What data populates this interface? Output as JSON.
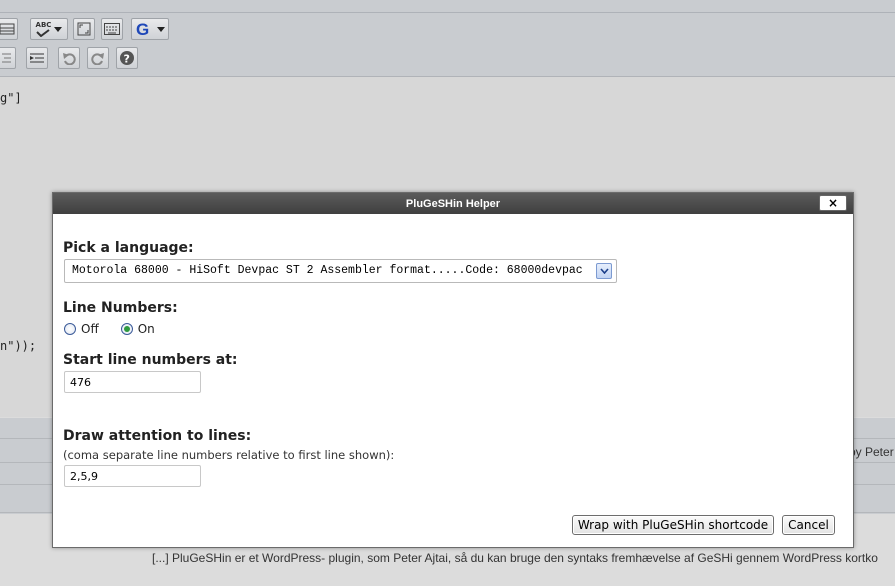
{
  "background": {
    "spellcheck_button_label": "ABC",
    "code_line_1": "g\"]",
    "code_line_2": "n\"));",
    "side_text": "by Peter",
    "excerpt": "[...] PluGeSHin er et WordPress- plugin, som Peter Ajtai, så du kan bruge den syntaks fremhævelse af GeSHi gennem WordPress kortko"
  },
  "dialog": {
    "title": "PluGeSHin Helper",
    "close_label": "×",
    "language": {
      "label": "Pick a language:",
      "selected": "Motorola 68000 - HiSoft Devpac ST 2 Assembler format.....Code: 68000devpac"
    },
    "line_numbers": {
      "label": "Line Numbers:",
      "options": [
        "Off",
        "On"
      ],
      "selected": "On"
    },
    "start_line": {
      "label": "Start line numbers at:",
      "value": "476"
    },
    "attention": {
      "label": "Draw attention to lines:",
      "hint": "(coma separate line numbers relative to first line shown):",
      "value": "2,5,9"
    },
    "buttons": {
      "wrap": "Wrap with PluGeSHin shortcode",
      "cancel": "Cancel"
    }
  },
  "colors": {
    "titlebar": "#4a4a4a",
    "radio_checked": "#2f9a3f",
    "overlay_background": "#d7d7d7"
  },
  "icons": [
    "table-icon",
    "spellcheck-icon",
    "fullscreen-icon",
    "keyboard-icon",
    "google-icon",
    "indent-icon",
    "outdent-icon",
    "undo-icon",
    "redo-icon",
    "help-icon",
    "close-icon",
    "dropdown-arrow-icon"
  ]
}
